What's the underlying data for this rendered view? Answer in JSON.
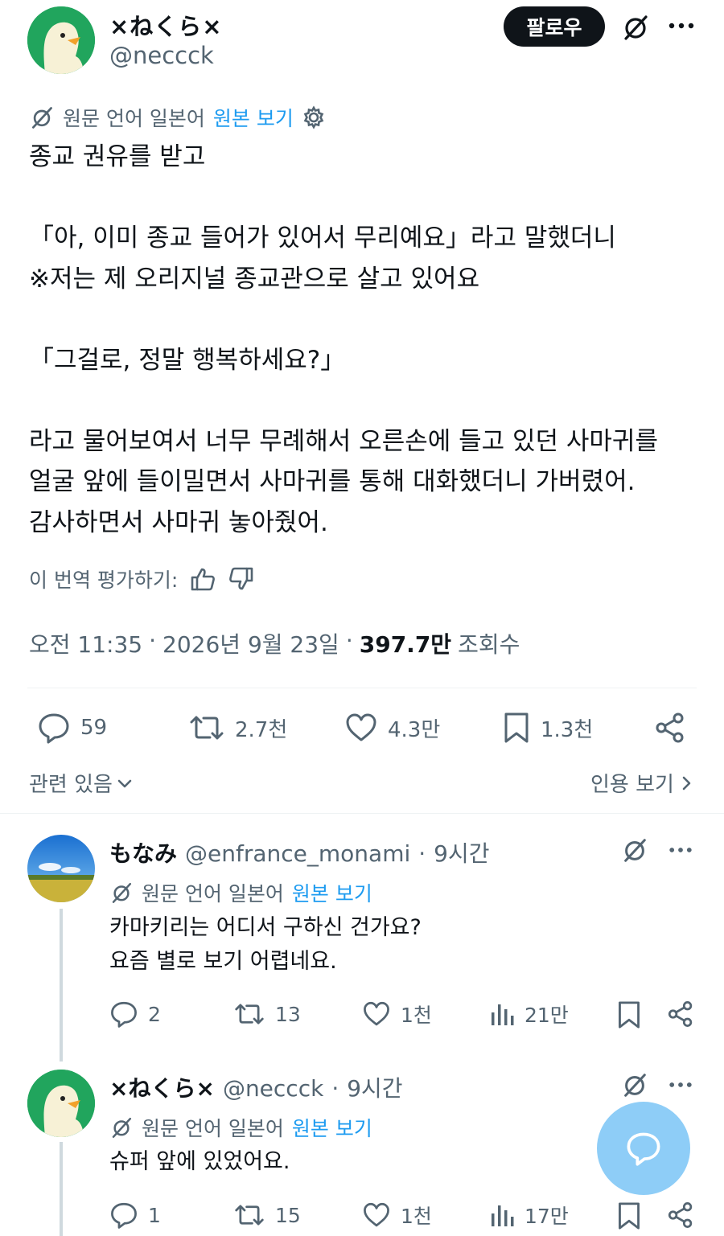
{
  "tweet": {
    "author": {
      "display_name": "×ねくら×",
      "handle": "@neccck"
    },
    "follow_label": "팔로우",
    "translation": {
      "label": "원문 언어 일본어",
      "show_original": "원본 보기"
    },
    "text": "종교 권유를 받고\n\n「아, 이미 종교 들어가 있어서 무리예요」라고 말했더니\n※저는 제 오리지널 종교관으로 살고 있어요\n\n「그걸로, 정말 행복하세요?」\n\n라고 물어보여서 너무 무례해서 오른손에 들고 있던 사마귀를\n얼굴 앞에 들이밀면서 사마귀를 통해 대화했더니 가버렸어.\n감사하면서 사마귀 놓아줬어.",
    "rate_label": "이 번역 평가하기:",
    "time": "오전 11:35",
    "date": "2026년 9월 23일",
    "views": "397.7만",
    "views_label": "조회수",
    "stats": {
      "replies": "59",
      "retweets": "2.7천",
      "likes": "4.3만",
      "bookmarks": "1.3천"
    },
    "related_label": "관련 있음",
    "quotes_label": "인용 보기"
  },
  "replies": [
    {
      "display_name": "もなみ",
      "handle": "@enfrance_monami",
      "time": "9시간",
      "translation_label": "원문 언어 일본어",
      "show_original": "원본 보기",
      "text": "카마키리는 어디서 구하신 건가요?\n요즘 별로 보기 어렵네요.",
      "stats": {
        "replies": "2",
        "retweets": "13",
        "likes": "1천",
        "views": "21만"
      }
    },
    {
      "display_name": "×ねくら×",
      "handle": "@neccck",
      "time": "9시간",
      "translation_label": "원문 언어 일본어",
      "show_original": "원본 보기",
      "text": "슈퍼 앞에 있었어요.",
      "stats": {
        "replies": "1",
        "retweets": "15",
        "likes": "1천",
        "views": "17만"
      }
    }
  ],
  "colors": {
    "accent": "#1d9bf0",
    "text": "#0f1419",
    "secondary": "#536471",
    "avatar_green": "#21a55d",
    "fab": "#8ecdf7"
  },
  "icons": [
    "grok-icon",
    "more-icon",
    "translate-icon",
    "gear-icon",
    "thumbs-up-icon",
    "thumbs-down-icon",
    "reply-icon",
    "retweet-icon",
    "like-icon",
    "bookmark-icon",
    "share-icon",
    "views-icon",
    "chevron-down-icon",
    "chevron-right-icon",
    "compose-reply-icon"
  ]
}
